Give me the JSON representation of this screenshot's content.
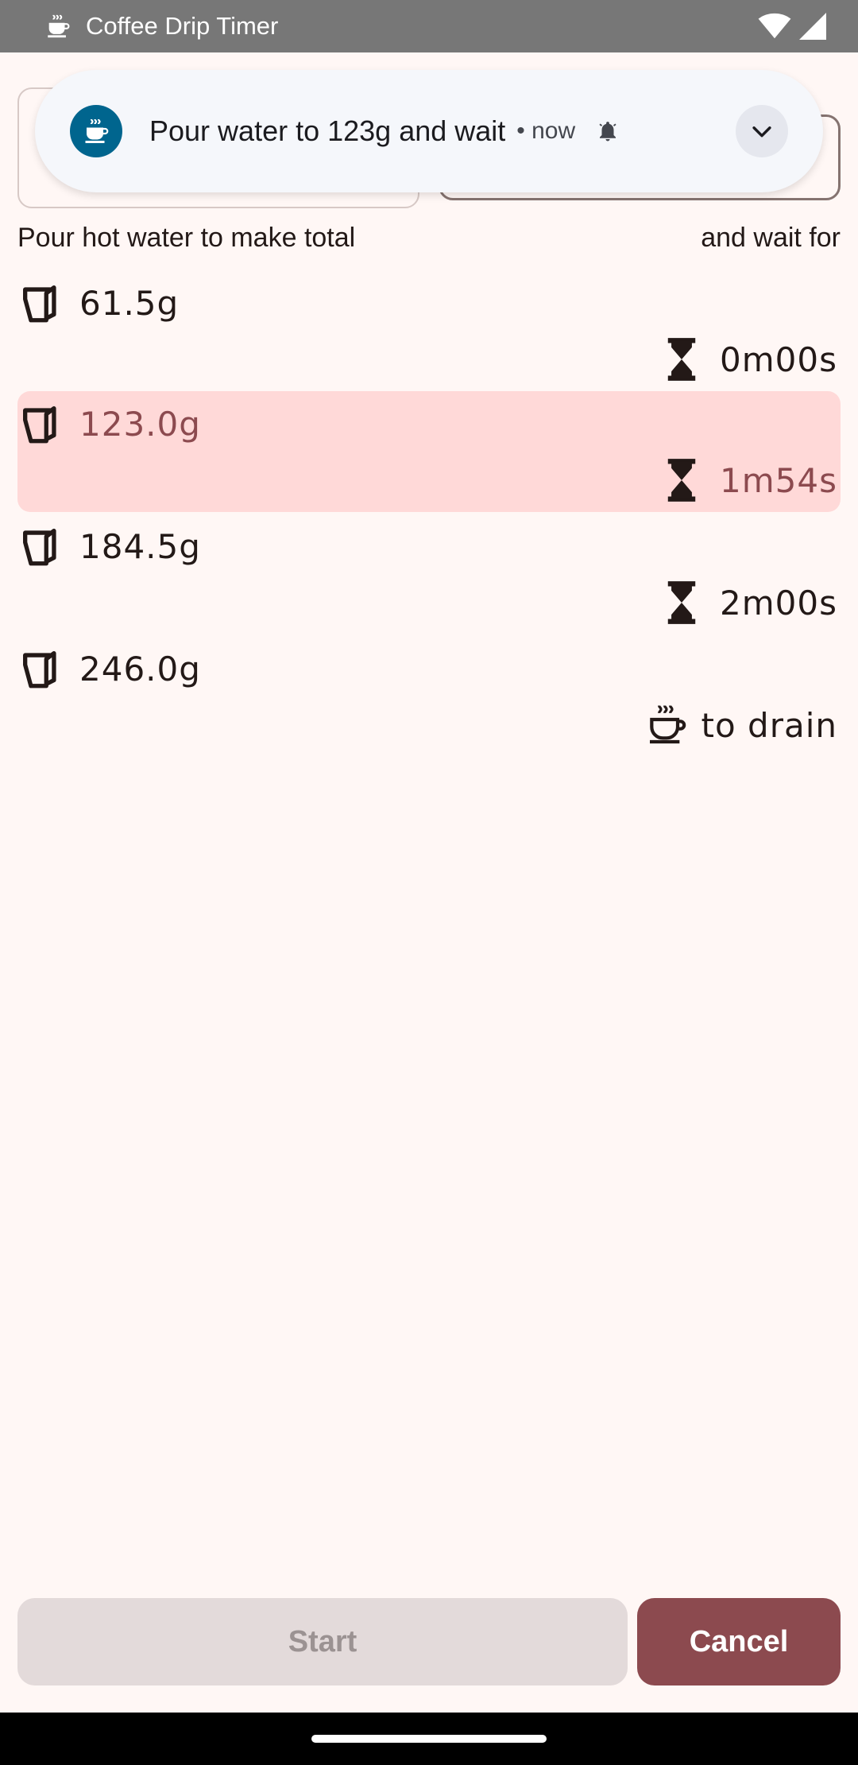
{
  "status_bar": {
    "app_title": "Coffee Drip Timer",
    "icons": [
      "coffee-icon",
      "wifi-icon",
      "signal-icon"
    ]
  },
  "notification": {
    "icon": "coffee-icon",
    "text": "Pour water to 123g and wait",
    "meta": "• now",
    "bell_icon": "bell-icon",
    "expand_icon": "chevron-down-icon",
    "accent": "#00658e"
  },
  "headers": {
    "left": "Pour hot water to make total",
    "right": "and wait for"
  },
  "steps": [
    {
      "amount": "61.5g",
      "duration": "0m00s",
      "wait_icon": "hourglass-icon",
      "active": false
    },
    {
      "amount": "123.0g",
      "duration": "1m54s",
      "wait_icon": "hourglass-icon",
      "active": true
    },
    {
      "amount": "184.5g",
      "duration": "2m00s",
      "wait_icon": "hourglass-icon",
      "active": false
    },
    {
      "amount": "246.0g",
      "duration": "to drain",
      "wait_icon": "coffee-cup-icon",
      "active": false
    }
  ],
  "buttons": {
    "start": "Start",
    "cancel": "Cancel"
  },
  "colors": {
    "background": "#fff7f5",
    "active_row": "#ffd9d8",
    "active_text": "#8c4a4f",
    "primary": "#8c4a4f"
  }
}
